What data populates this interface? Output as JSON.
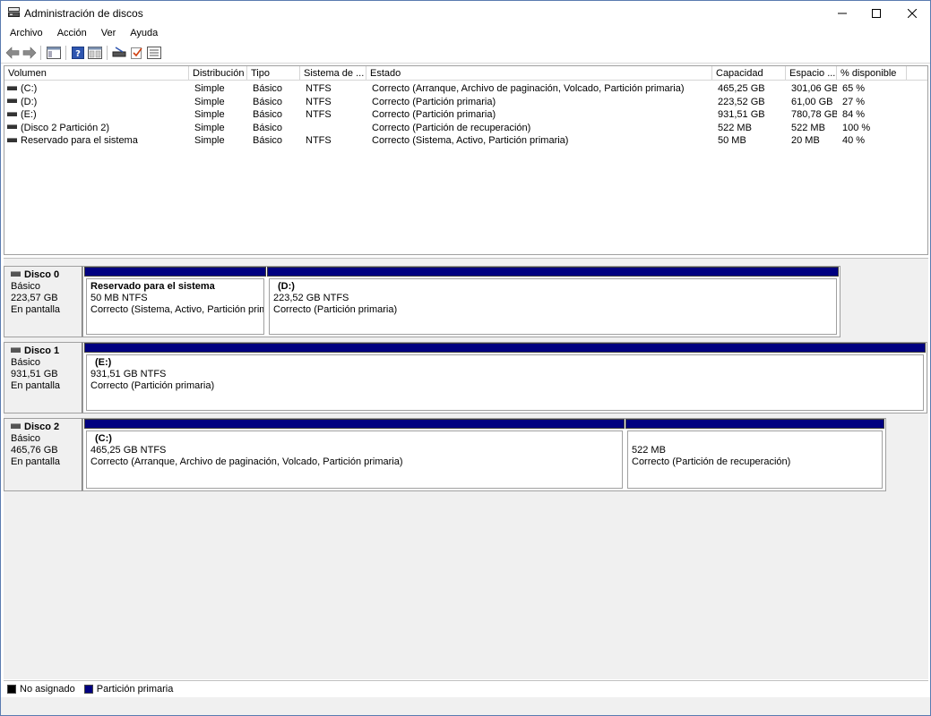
{
  "window": {
    "title": "Administración de discos"
  },
  "menu": [
    "Archivo",
    "Acción",
    "Ver",
    "Ayuda"
  ],
  "toolbar": {
    "icons": [
      "back-icon",
      "forward-icon",
      "console-tree-icon",
      "help-icon",
      "properties-icon",
      "connect-icon",
      "check-icon",
      "list-icon"
    ]
  },
  "volume_list": {
    "columns": [
      "Volumen",
      "Distribución",
      "Tipo",
      "Sistema de ...",
      "Estado",
      "Capacidad",
      "Espacio ...",
      "% disponible"
    ],
    "rows": [
      [
        "(C:)",
        "Simple",
        "Básico",
        "NTFS",
        "Correcto (Arranque, Archivo de paginación, Volcado, Partición primaria)",
        "465,25 GB",
        "301,06 GB",
        "65 %"
      ],
      [
        "(D:)",
        "Simple",
        "Básico",
        "NTFS",
        "Correcto (Partición primaria)",
        "223,52 GB",
        "61,00 GB",
        "27 %"
      ],
      [
        "(E:)",
        "Simple",
        "Básico",
        "NTFS",
        "Correcto (Partición primaria)",
        "931,51 GB",
        "780,78 GB",
        "84 %"
      ],
      [
        "(Disco 2 Partición 2)",
        "Simple",
        "Básico",
        "",
        "Correcto (Partición de recuperación)",
        "522 MB",
        "522 MB",
        "100 %"
      ],
      [
        "Reservado para el sistema",
        "Simple",
        "Básico",
        "NTFS",
        "Correcto (Sistema, Activo, Partición primaria)",
        "50 MB",
        "20 MB",
        "40 %"
      ]
    ]
  },
  "disks": [
    {
      "name": "Disco 0",
      "type": "Básico",
      "size": "223,57 GB",
      "state": "En pantalla",
      "partitions": [
        {
          "name": "Reservado para el sistema",
          "size": "50 MB NTFS",
          "status": "Correcto (Sistema, Activo, Partición prima"
        },
        {
          "name": "(D:)",
          "size": "223,52 GB NTFS",
          "status": "Correcto (Partición primaria)"
        }
      ]
    },
    {
      "name": "Disco 1",
      "type": "Básico",
      "size": "931,51 GB",
      "state": "En pantalla",
      "partitions": [
        {
          "name": "(E:)",
          "size": "931,51 GB NTFS",
          "status": "Correcto (Partición primaria)"
        }
      ]
    },
    {
      "name": "Disco 2",
      "type": "Básico",
      "size": "465,76 GB",
      "state": "En pantalla",
      "partitions": [
        {
          "name": "(C:)",
          "size": "465,25 GB NTFS",
          "status": "Correcto (Arranque, Archivo de paginación, Volcado, Partición primaria)"
        },
        {
          "name": "",
          "size": "522 MB",
          "status": "Correcto (Partición de recuperación)"
        }
      ]
    }
  ],
  "legend": [
    {
      "label": "No asignado",
      "color": "#000000"
    },
    {
      "label": "Partición primaria",
      "color": "#000080"
    }
  ]
}
